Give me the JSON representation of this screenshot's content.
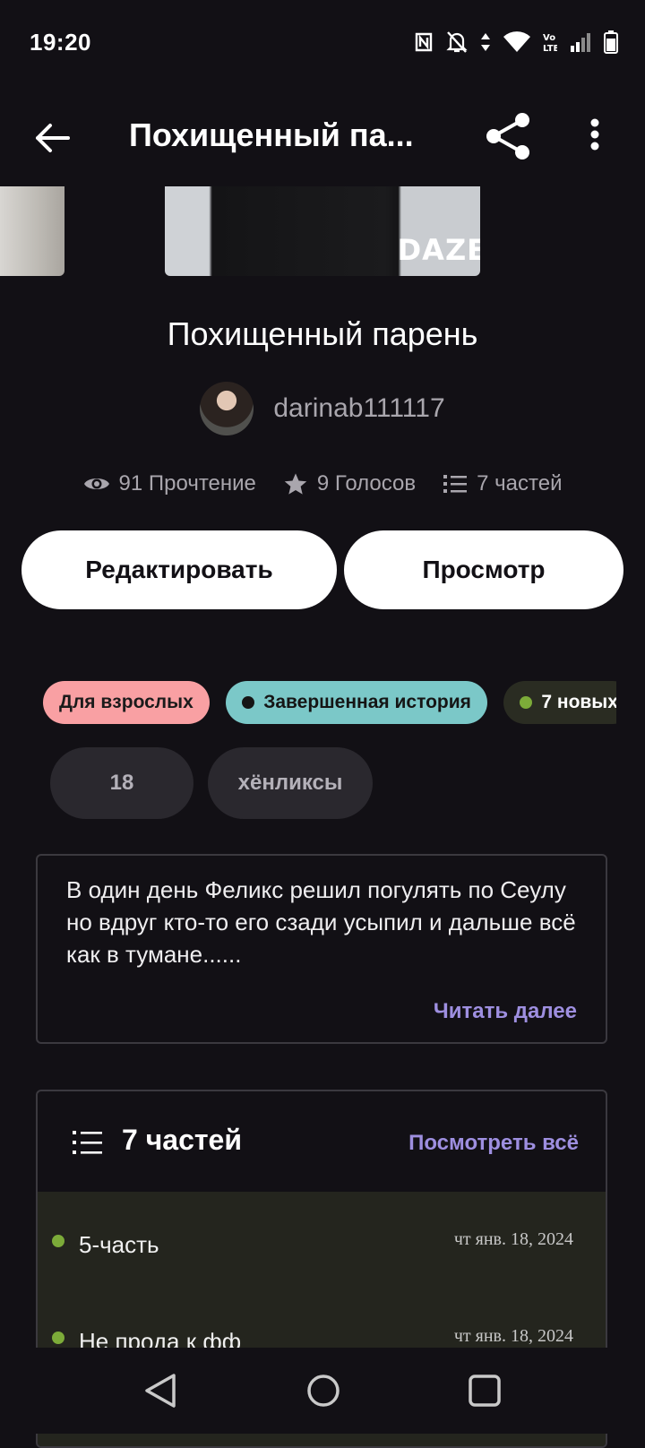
{
  "status_bar": {
    "time": "19:20",
    "icons": [
      "nfc-icon",
      "bell-off-icon",
      "data-arrows-icon",
      "wifi-icon",
      "volte-icon",
      "signal-icon",
      "battery-icon"
    ]
  },
  "app_bar": {
    "title": "Похищенный па...",
    "icons": [
      "back-arrow-icon",
      "share-icon",
      "more-vert-icon"
    ]
  },
  "cover": {
    "brand_text": "DAZE"
  },
  "story": {
    "title": "Похищенный парень",
    "author": "darinab111117",
    "stats": {
      "reads": "91 Прочтение",
      "votes": "9 Голосов",
      "parts": "7 частей"
    }
  },
  "actions": {
    "edit_label": "Редактировать",
    "view_label": "Просмотр"
  },
  "tags": {
    "mature": "Для взрослых",
    "complete": "Завершенная история",
    "new_parts": "7 новых"
  },
  "chips": [
    "18",
    "хёнликсы"
  ],
  "description": {
    "text": "В один день Феликс решил погулять по Сеулу но вдруг кто-то его сзади усыпил и дальше всё как в тумане......",
    "read_more": "Читать далее"
  },
  "parts_section": {
    "title": "7 частей",
    "see_all": "Посмотреть всё",
    "items": [
      {
        "title": "5-часть",
        "date": "чт янв. 18, 2024"
      },
      {
        "title": "Не прода к фф",
        "date": "чт янв. 18, 2024"
      }
    ]
  },
  "colors": {
    "background": "#121015",
    "accent_link": "#9e8fe0",
    "tag_mature": "#f9a0a3",
    "tag_complete": "#7bc8c8",
    "part_dot": "#7cab39"
  }
}
